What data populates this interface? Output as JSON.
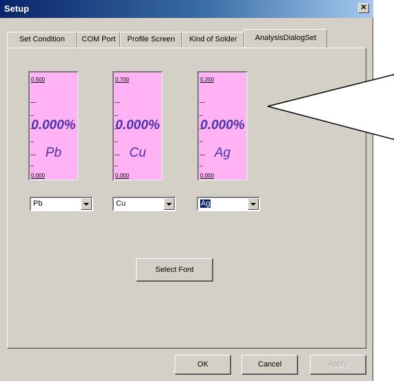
{
  "window": {
    "title": "Setup",
    "close_symbol": "✕"
  },
  "tabs": [
    {
      "label": "Set Condition"
    },
    {
      "label": "COM Port"
    },
    {
      "label": "Profile Screen"
    },
    {
      "label": "Kind of Solder"
    },
    {
      "label": "AnalysisDialogSet"
    }
  ],
  "active_tab": "AnalysisDialogSet",
  "gauges": [
    {
      "max": "0.500",
      "min": "0.000",
      "value": "0.000%",
      "element": "Pb"
    },
    {
      "max": "0.700",
      "min": "0.000",
      "value": "0.000%",
      "element": "Cu"
    },
    {
      "max": "0.200",
      "min": "0.000",
      "value": "0.000%",
      "element": "Ag"
    }
  ],
  "selects": [
    {
      "value": "Pb"
    },
    {
      "value": "Cu"
    },
    {
      "value": "Ag"
    }
  ],
  "buttons": {
    "select_font": "Select Font",
    "ok": "OK",
    "cancel": "Cancel",
    "apply": "Apply"
  },
  "colors": {
    "gauge_fill": "#ffb3f5",
    "gauge_text": "#4b32a8",
    "title_bar": "#0a246a",
    "dialog_face": "#d4d0c8"
  }
}
